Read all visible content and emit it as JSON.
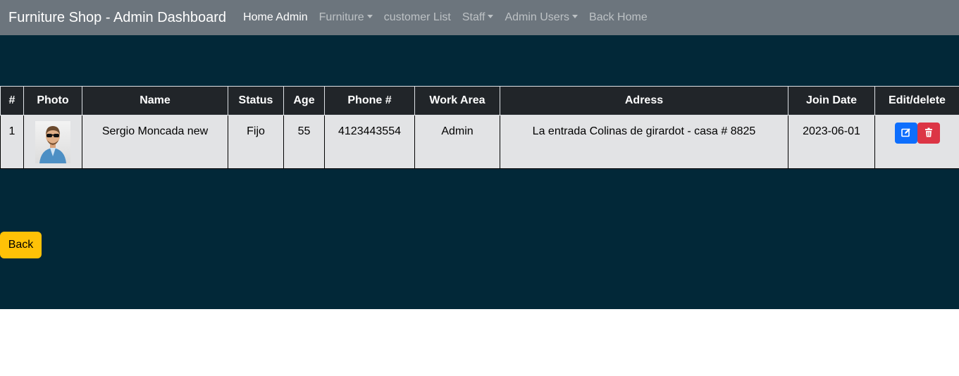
{
  "navbar": {
    "brand": "Furniture Shop - Admin Dashboard",
    "links": [
      {
        "label": "Home Admin",
        "active": true,
        "dropdown": false
      },
      {
        "label": "Furniture",
        "active": false,
        "dropdown": true
      },
      {
        "label": "customer List",
        "active": false,
        "dropdown": false
      },
      {
        "label": "Staff",
        "active": false,
        "dropdown": true
      },
      {
        "label": "Admin Users",
        "active": false,
        "dropdown": true
      },
      {
        "label": "Back Home",
        "active": false,
        "dropdown": false
      }
    ]
  },
  "table": {
    "headers": [
      "#",
      "Photo",
      "Name",
      "Status",
      "Age",
      "Phone #",
      "Work Area",
      "Adress",
      "Join Date",
      "Edit/delete"
    ],
    "rows": [
      {
        "num": "1",
        "photo_icon": "person-photo",
        "name": "Sergio Moncada new",
        "status": "Fijo",
        "age": "55",
        "phone": "4123443554",
        "work_area": "Admin",
        "address": "La entrada Colinas de girardot - casa # 8825",
        "join_date": "2023-06-01",
        "edit_icon": "edit-icon",
        "delete_icon": "trash-icon"
      }
    ]
  },
  "back_button": "Back",
  "colors": {
    "navbar_bg": "#6c757d",
    "main_bg": "#022838",
    "header_bg": "#212529",
    "row_bg": "#e2e3e5",
    "edit_btn": "#0d6efd",
    "delete_btn": "#dc3545",
    "back_btn": "#ffc107"
  }
}
